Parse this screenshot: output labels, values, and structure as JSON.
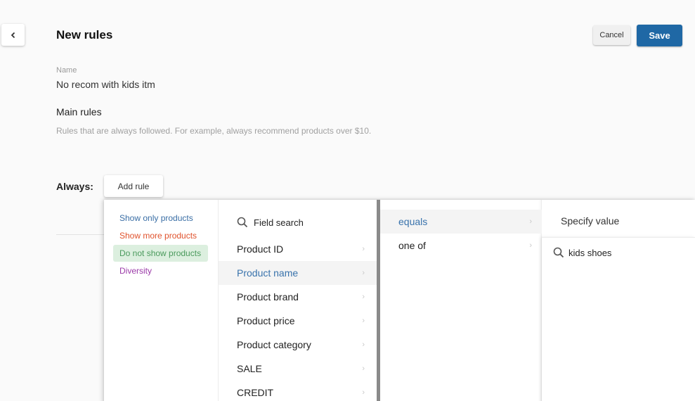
{
  "header": {
    "back_icon": "chevron-left-icon",
    "title": "New rules",
    "cancel_label": "Cancel",
    "save_label": "Save"
  },
  "form": {
    "name_label": "Name",
    "name_value": "No recom with kids itm",
    "section_title": "Main rules",
    "section_description": "Rules that are always followed. For example, always recommend products over $10.",
    "always_label": "Always:",
    "add_rule_label": "Add rule"
  },
  "dropdown": {
    "rule_types": [
      {
        "label": "Show only products",
        "color": "#3a6ea5",
        "active": false
      },
      {
        "label": "Show more products",
        "color": "#e0522c",
        "active": false
      },
      {
        "label": "Do not show products",
        "color": "#4a9a5c",
        "active": true
      },
      {
        "label": "Diversity",
        "color": "#9b3aa8",
        "active": false
      }
    ],
    "field_search_placeholder": "Field search",
    "fields": [
      {
        "label": "Product ID",
        "active": false
      },
      {
        "label": "Product name",
        "active": true
      },
      {
        "label": "Product brand",
        "active": false
      },
      {
        "label": "Product price",
        "active": false
      },
      {
        "label": "Product category",
        "active": false
      },
      {
        "label": "SALE",
        "active": false
      },
      {
        "label": "CREDIT",
        "active": false
      }
    ],
    "operators": [
      {
        "label": "equals",
        "active": true
      },
      {
        "label": "one of",
        "active": false
      }
    ],
    "value_title": "Specify value",
    "value_input": "kids shoes"
  },
  "colors": {
    "primary": "#1f68a5",
    "active_link": "#3973ac",
    "active_type_bg": "#dcefdf"
  }
}
